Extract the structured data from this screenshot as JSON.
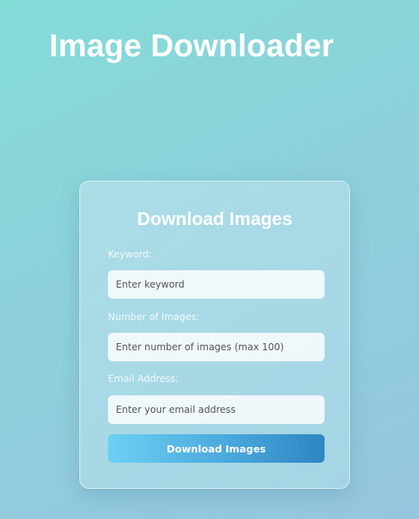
{
  "header": {
    "title": "Image Downloader"
  },
  "form": {
    "heading": "Download Images",
    "keyword": {
      "label": "Keyword:",
      "placeholder": "Enter keyword",
      "value": ""
    },
    "count": {
      "label": "Number of Images:",
      "placeholder": "Enter number of images (max 100)",
      "value": ""
    },
    "email": {
      "label": "Email Address:",
      "placeholder": "Enter your email address",
      "value": ""
    },
    "submit_label": "Download Images"
  },
  "colors": {
    "background_start": "#84dcd9",
    "background_end": "#96c6df",
    "button_start": "#6dd0f3",
    "button_end": "#2f86c2",
    "text": "#ffffff"
  }
}
